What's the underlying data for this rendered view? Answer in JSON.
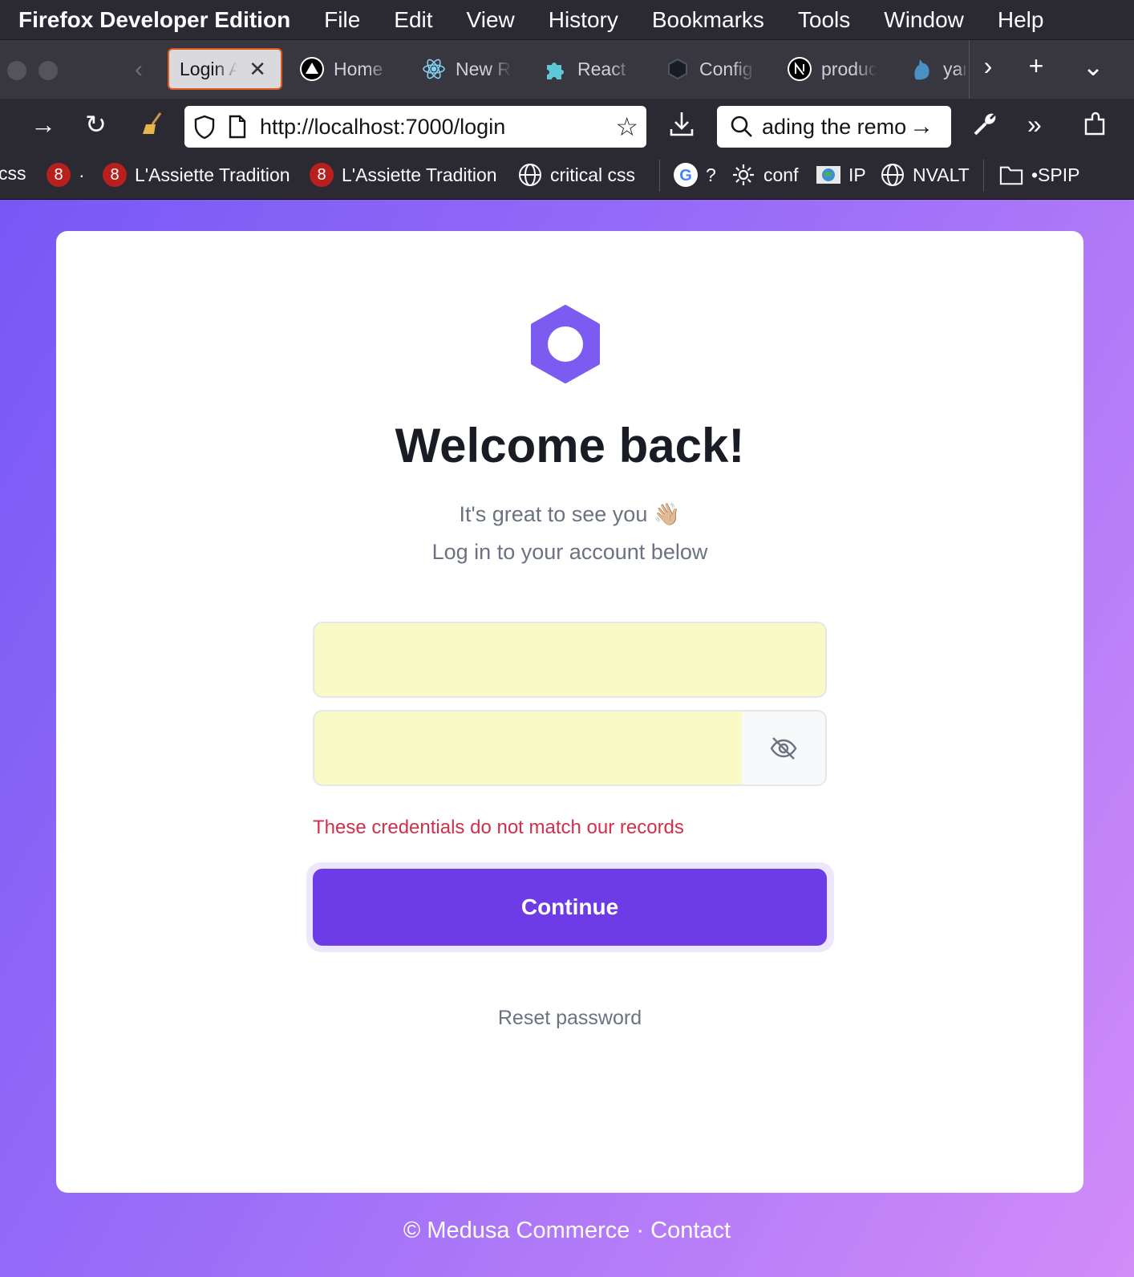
{
  "menubar": {
    "app_name": "Firefox Developer Edition",
    "items": [
      "File",
      "Edit",
      "View",
      "History",
      "Bookmarks",
      "Tools",
      "Window",
      "Help"
    ]
  },
  "tabs": [
    {
      "label": "Login Ac",
      "icon": "none",
      "active": true
    },
    {
      "label": "Home",
      "icon": "triangle-logo-icon"
    },
    {
      "label": "New R",
      "icon": "react-icon"
    },
    {
      "label": "React",
      "icon": "puzzle-icon"
    },
    {
      "label": "Config",
      "icon": "medusa-hex-icon"
    },
    {
      "label": "produc",
      "icon": "nextjs-icon"
    },
    {
      "label": "yar",
      "icon": "yarn-cat-icon"
    }
  ],
  "navbar": {
    "url": "http://localhost:7000/login",
    "search_text": "ading the remo"
  },
  "bookmarks": [
    {
      "label": "css",
      "icon": "none"
    },
    {
      "label": "·",
      "icon": "red-circle-icon"
    },
    {
      "label": "L'Assiette Tradition",
      "icon": "red-circle-icon"
    },
    {
      "label": "L'Assiette Tradition",
      "icon": "red-circle-icon"
    },
    {
      "label": "critical css",
      "icon": "globe-icon"
    },
    {
      "label": "?",
      "icon": "google-icon"
    },
    {
      "label": "conf",
      "icon": "gear-icon"
    },
    {
      "label": "IP",
      "icon": "network-icon"
    },
    {
      "label": "NVALT",
      "icon": "globe-icon"
    },
    {
      "label": "•SPIP",
      "icon": "folder-icon"
    }
  ],
  "login": {
    "title": "Welcome back!",
    "subtitle_line1": "It's great to see you 👋🏼",
    "subtitle_line2": "Log in to your account below",
    "email_value": "",
    "password_value": "",
    "error": "These credentials do not match our records",
    "continue_label": "Continue",
    "reset_label": "Reset password"
  },
  "footer": {
    "text": "© Medusa Commerce · Contact"
  },
  "colors": {
    "accent": "#6d3ce6",
    "error": "#d0304a",
    "autofill": "#fafac7"
  }
}
